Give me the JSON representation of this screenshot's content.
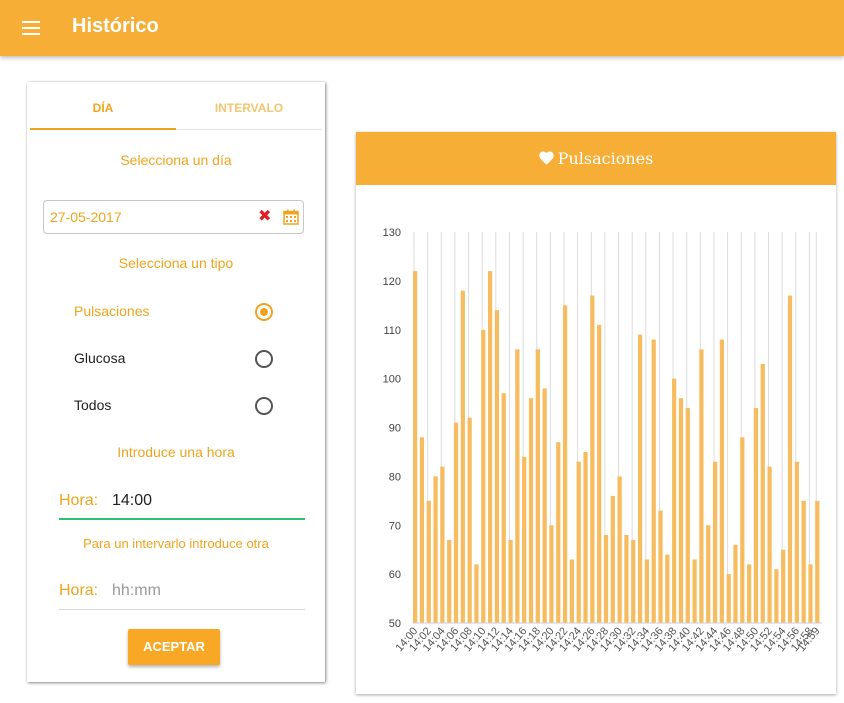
{
  "appbar": {
    "title": "Histórico"
  },
  "tabs": [
    {
      "label": "DÍA"
    },
    {
      "label": "INTERVALO"
    }
  ],
  "form": {
    "day_label": "Selecciona un día",
    "date_value": "27-05-2017",
    "type_label": "Selecciona un tipo",
    "types": [
      {
        "label": "Pulsaciones",
        "selected": true
      },
      {
        "label": "Glucosa",
        "selected": false
      },
      {
        "label": "Todos",
        "selected": false
      }
    ],
    "hour_label": "Introduce una hora",
    "hour_prefix": "Hora:",
    "hour_value": "14:00",
    "interval_label": "Para un intervarlo introduce otra",
    "hour2_prefix": "Hora:",
    "hour2_placeholder": "hh:mm",
    "accept_label": "ACEPTAR"
  },
  "colors": {
    "accent": "#f7ae36",
    "text_accent": "#f0a41d",
    "bar": "#f7bc5f",
    "focus_line": "#2fbf71",
    "clear": "#e02121"
  },
  "card": {
    "title": "Pulsaciones",
    "icon": "heart-icon"
  },
  "chart_data": {
    "type": "bar",
    "categories": [
      "14:00",
      "14:01",
      "14:02",
      "14:03",
      "14:04",
      "14:05",
      "14:06",
      "14:07",
      "14:08",
      "14:09",
      "14:10",
      "14:11",
      "14:12",
      "14:13",
      "14:14",
      "14:15",
      "14:16",
      "14:17",
      "14:18",
      "14:19",
      "14:20",
      "14:21",
      "14:22",
      "14:23",
      "14:24",
      "14:25",
      "14:26",
      "14:27",
      "14:28",
      "14:29",
      "14:30",
      "14:31",
      "14:32",
      "14:33",
      "14:34",
      "14:35",
      "14:36",
      "14:37",
      "14:38",
      "14:39",
      "14:40",
      "14:41",
      "14:42",
      "14:43",
      "14:44",
      "14:45",
      "14:46",
      "14:47",
      "14:48",
      "14:49",
      "14:50",
      "14:51",
      "14:52",
      "14:53",
      "14:54",
      "14:55",
      "14:56",
      "14:57",
      "14:58",
      "14:59"
    ],
    "x_tick_labels": [
      "14:00",
      "14:02",
      "14:04",
      "14:06",
      "14:08",
      "14:10",
      "14:12",
      "14:14",
      "14:16",
      "14:18",
      "14:20",
      "14:22",
      "14:24",
      "14:26",
      "14:28",
      "14:30",
      "14:32",
      "14:34",
      "14:36",
      "14:38",
      "14:40",
      "14:42",
      "14:44",
      "14:46",
      "14:48",
      "14:50",
      "14:52",
      "14:54",
      "14:56",
      "14:58",
      "14:59"
    ],
    "values": [
      122,
      88,
      75,
      80,
      82,
      67,
      91,
      118,
      92,
      62,
      110,
      122,
      114,
      97,
      67,
      106,
      84,
      96,
      106,
      98,
      70,
      87,
      115,
      63,
      83,
      85,
      117,
      111,
      68,
      76,
      80,
      68,
      67,
      109,
      63,
      108,
      73,
      64,
      100,
      96,
      94,
      63,
      106,
      70,
      83,
      108,
      60,
      66,
      88,
      62,
      94,
      103,
      82,
      61,
      65,
      117,
      83,
      75,
      62,
      75
    ],
    "ylim": [
      50,
      130
    ],
    "y_ticks": [
      50,
      60,
      70,
      80,
      90,
      100,
      110,
      120,
      130
    ],
    "grid": "vertical",
    "legend": "none"
  }
}
